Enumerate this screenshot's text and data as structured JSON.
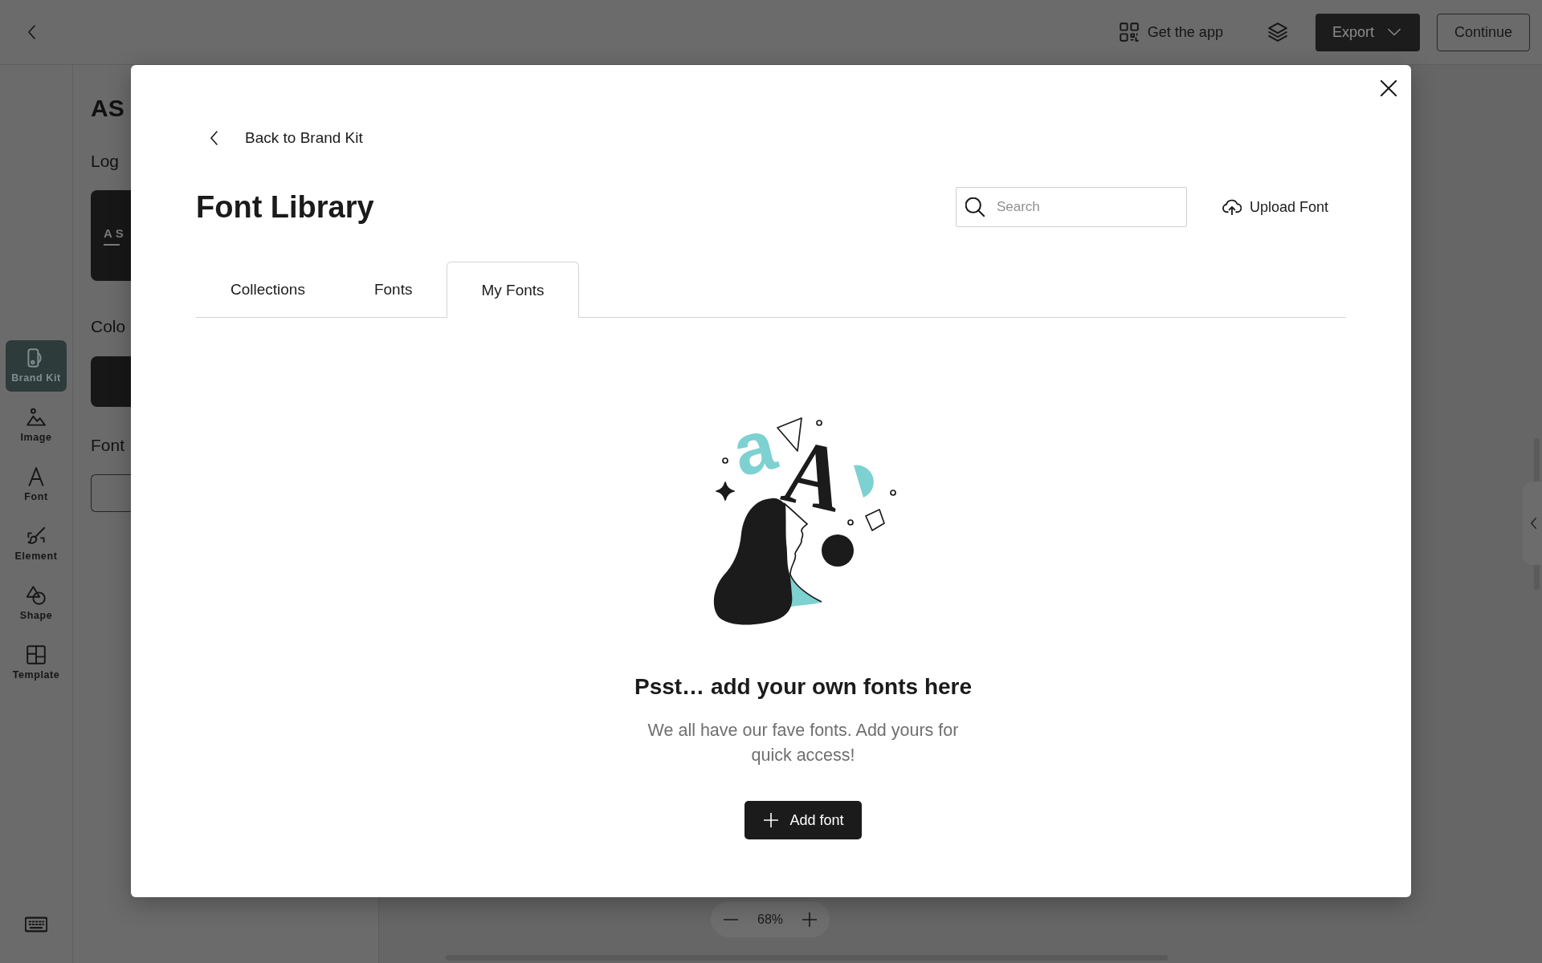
{
  "top_bar": {
    "get_app": "Get the app",
    "export_button": "Export",
    "continue_button": "Continue"
  },
  "tool_rail": {
    "items": [
      {
        "label": "Brand Kit",
        "selected": true
      },
      {
        "label": "Image",
        "selected": false
      },
      {
        "label": "Font",
        "selected": false
      },
      {
        "label": "Element",
        "selected": false
      },
      {
        "label": "Shape",
        "selected": false
      },
      {
        "label": "Template",
        "selected": false
      }
    ]
  },
  "brand_panel": {
    "title": "AS",
    "logo_heading": "Log",
    "logo_text": "AS",
    "colors_heading": "Colo",
    "fonts_heading": "Font"
  },
  "canvas": {
    "zoom_level": "68%"
  },
  "modal": {
    "back_link": "Back to Brand Kit",
    "title": "Font Library",
    "search": {
      "placeholder": "Search"
    },
    "upload_button": "Upload Font",
    "tabs": [
      {
        "label": "Collections",
        "selected": false
      },
      {
        "label": "Fonts",
        "selected": false
      },
      {
        "label": "My Fonts",
        "selected": true
      }
    ],
    "empty_state": {
      "illustration_letters": [
        {
          "text": "a",
          "kind": "sans"
        },
        {
          "text": "A",
          "kind": "serif"
        }
      ],
      "heading": "Psst… add your own fonts here",
      "description": "We all have our fave fonts. Add yours for quick access!",
      "button": "Add font"
    }
  }
}
